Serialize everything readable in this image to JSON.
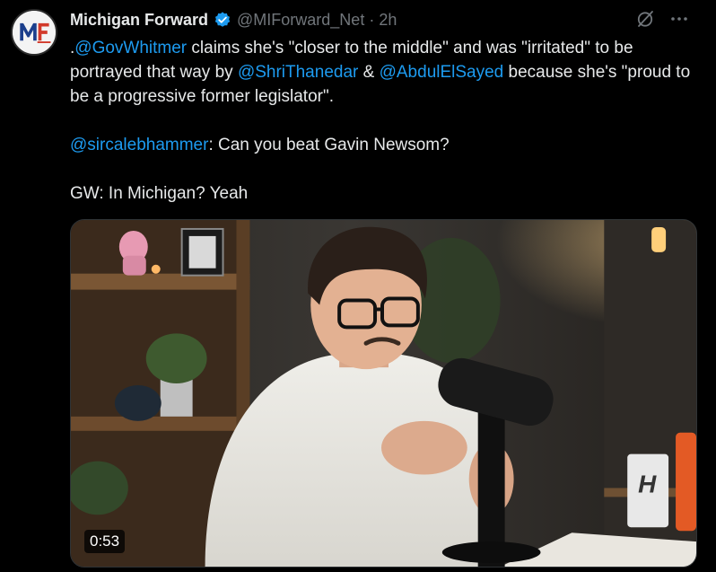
{
  "tweet": {
    "author_name": "Michigan Forward",
    "handle": "@MIForward_Net",
    "separator": "·",
    "time": "2h",
    "avatar_icon": "michigan-forward-logo",
    "body": {
      "p1_prefix": ".",
      "mention_whitmer": "@GovWhitmer",
      "p1_text_a": " claims she's \"closer to the middle\" and was \"irritated\" to be portrayed that way by ",
      "mention_thanedar": "@ShriThanedar",
      "p1_amp": " & ",
      "mention_elsayed": "@AbdulElSayed",
      "p1_text_b": " because she's \"proud to be a progressive former legislator\".",
      "mention_hammer": "@sircalebhammer",
      "p2_text": ": Can you beat Gavin Newsom?",
      "p3_text": "GW: In Michigan? Yeah"
    },
    "media": {
      "duration": "0:53",
      "mug_label": "H"
    }
  },
  "colors": {
    "background": "#000000",
    "text": "#e7e9ea",
    "muted": "#71767b",
    "link": "#1d9bf0",
    "verified": "#1d9bf0"
  }
}
